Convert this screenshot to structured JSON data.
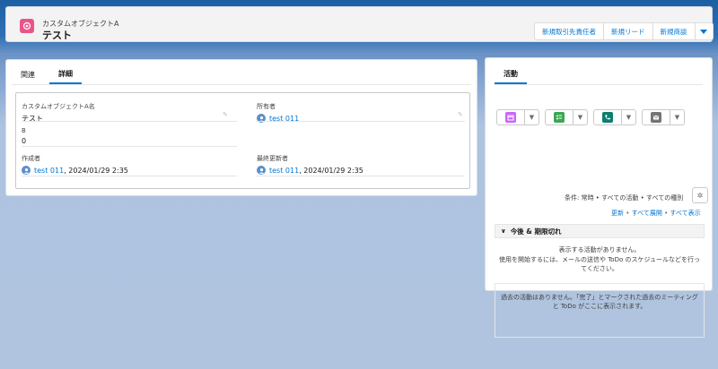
{
  "header": {
    "object_type": "カスタムオブジェクトA",
    "record_name": "テスト",
    "buttons": [
      "新規取引先責任者",
      "新規リード",
      "新規商談"
    ],
    "accent": "#e8558a"
  },
  "record_tabs": [
    "関連",
    "詳細"
  ],
  "active_record_tab": "詳細",
  "fields": {
    "name": {
      "label": "カスタムオブジェクトA名",
      "value": "テスト"
    },
    "owner": {
      "label": "所有者",
      "value": "test 011"
    },
    "b": {
      "label": "B",
      "value": "0"
    },
    "created_by": {
      "label": "作成者",
      "user": "test 011",
      "date": ", 2024/01/29 2:35"
    },
    "modified_by": {
      "label": "最終更新者",
      "user": "test 011",
      "date": ", 2024/01/29 2:35"
    }
  },
  "activity": {
    "tab": "活動",
    "action_icons": [
      {
        "name": "event-icon",
        "color": "#cb65ff"
      },
      {
        "name": "task-icon",
        "color": "#3ba755"
      },
      {
        "name": "call-icon",
        "color": "#0e7e6e"
      },
      {
        "name": "email-icon",
        "color": "#747474"
      }
    ],
    "filter_text": "条件: 常時 • すべての活動 • すべての種別",
    "links": [
      "更新",
      "すべて展開",
      "すべて表示"
    ],
    "upcoming_title": "今後 & 期限切れ",
    "upcoming_msg1": "表示する活動がありません。",
    "upcoming_msg2a": "使用を開始するには、メールの送信や ToDo のスケジュールなどを行っ",
    "upcoming_msg2b": "てください。",
    "past_msg_a": "過去の活動はありません。「完了」とマークされた過去のミーティング",
    "past_msg_b": "と ToDo がここに表示されます。"
  }
}
